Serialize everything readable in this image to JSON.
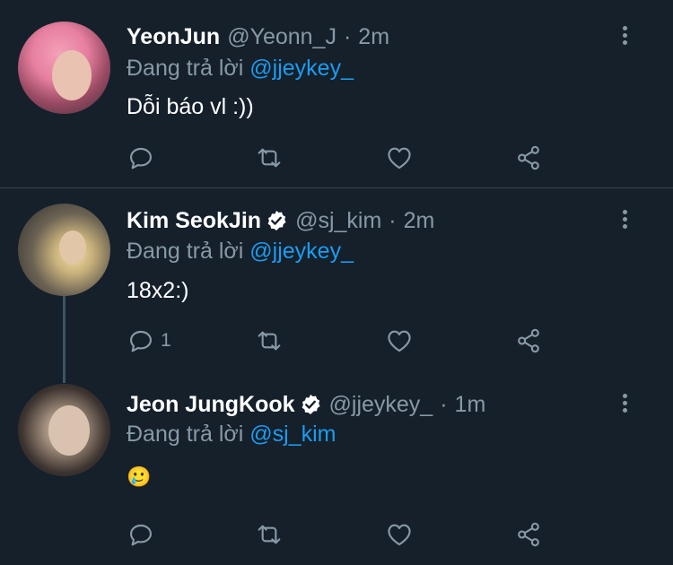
{
  "colors": {
    "background": "#15202b",
    "text": "#ffffff",
    "muted": "#8899a6",
    "link": "#1d9bf0",
    "divider": "#38444d",
    "verified": "#ffffff"
  },
  "icons": {
    "reply": "reply-icon",
    "retweet": "retweet-icon",
    "like": "heart-icon",
    "share": "share-icon",
    "more": "more-icon",
    "verified": "verified-badge-icon"
  },
  "tweets": [
    {
      "name": "YeonJun",
      "verified": false,
      "handle": "@Yeonn_J",
      "sep": "·",
      "time": "2m",
      "reply_prefix": "Đang trả lời ",
      "reply_to": "@jjeykey_",
      "text": "Dỗi báo vl :))",
      "reply_count": ""
    },
    {
      "name": "Kim SeokJin",
      "verified": true,
      "handle": "@sj_kim",
      "sep": "·",
      "time": "2m",
      "reply_prefix": "Đang trả lời ",
      "reply_to": "@jjeykey_",
      "text": "18x2:)",
      "reply_count": "1"
    },
    {
      "name": "Jeon JungKook",
      "verified": true,
      "handle": "@jjeykey_",
      "sep": "·",
      "time": "1m",
      "reply_prefix": "Đang trả lời ",
      "reply_to": "@sj_kim",
      "text": "🥲",
      "reply_count": ""
    }
  ]
}
